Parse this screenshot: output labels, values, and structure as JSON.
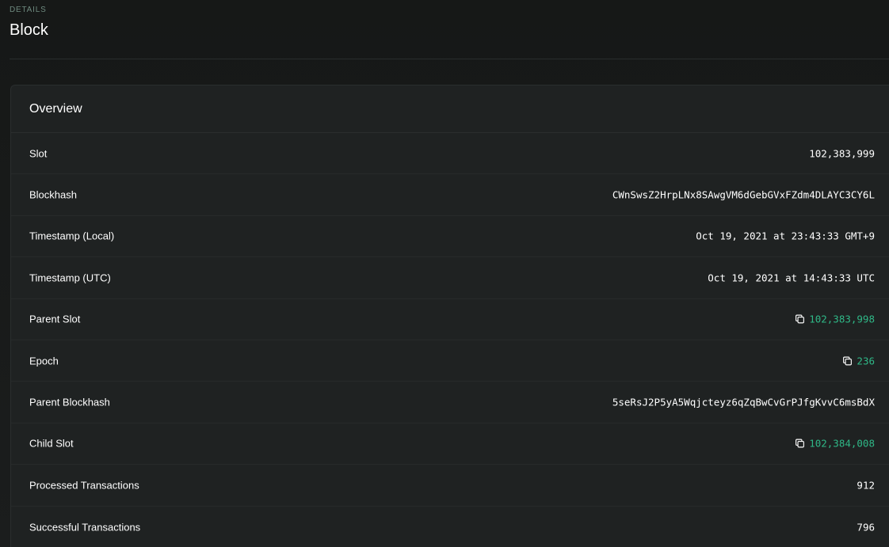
{
  "header": {
    "pretitle": "DETAILS",
    "title": "Block"
  },
  "overview": {
    "title": "Overview",
    "rows": [
      {
        "label": "Slot",
        "value": "102,383,999",
        "link": false,
        "copy": false
      },
      {
        "label": "Blockhash",
        "value": "CWnSwsZ2HrpLNx8SAwgVM6dGebGVxFZdm4DLAYC3CY6L",
        "link": false,
        "copy": false
      },
      {
        "label": "Timestamp (Local)",
        "value": "Oct 19, 2021 at 23:43:33 GMT+9",
        "link": false,
        "copy": false
      },
      {
        "label": "Timestamp (UTC)",
        "value": "Oct 19, 2021 at 14:43:33 UTC",
        "link": false,
        "copy": false
      },
      {
        "label": "Parent Slot",
        "value": "102,383,998",
        "link": true,
        "copy": true
      },
      {
        "label": "Epoch",
        "value": "236",
        "link": true,
        "copy": true
      },
      {
        "label": "Parent Blockhash",
        "value": "5seRsJ2P5yA5Wqjcteyz6qZqBwCvGrPJfgKvvC6msBdX",
        "link": false,
        "copy": false
      },
      {
        "label": "Child Slot",
        "value": "102,384,008",
        "link": true,
        "copy": true
      },
      {
        "label": "Processed Transactions",
        "value": "912",
        "link": false,
        "copy": false
      },
      {
        "label": "Successful Transactions",
        "value": "796",
        "link": false,
        "copy": false
      }
    ]
  },
  "colors": {
    "background": "#191b1b",
    "card": "#1f2222",
    "accent": "#2fb887",
    "pretitle": "#6e8a7f"
  },
  "icons": {
    "copy": "copy-icon"
  }
}
